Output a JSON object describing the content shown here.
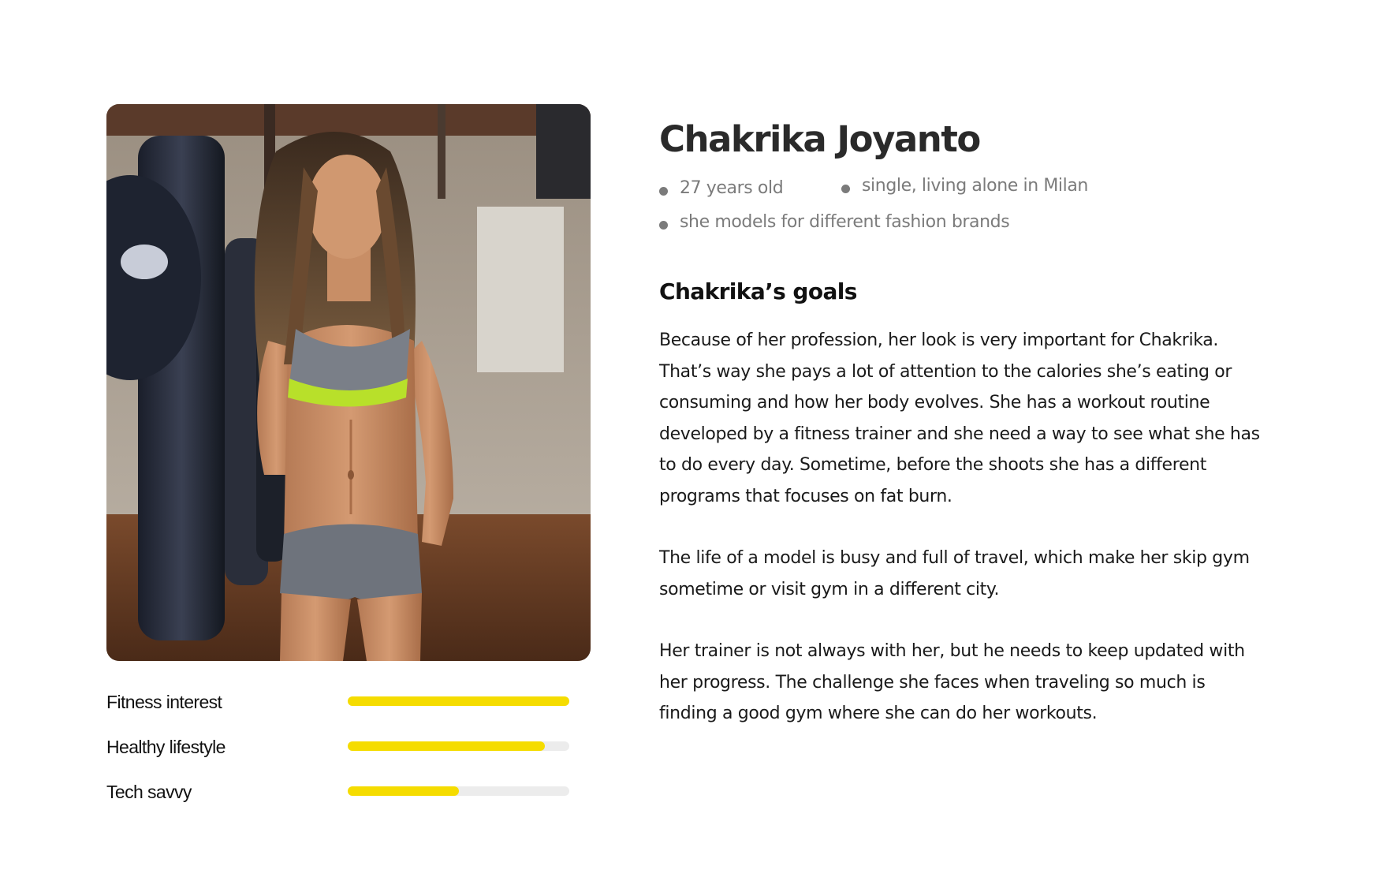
{
  "persona": {
    "name": "Chakrika Joyanto",
    "facts": [
      "27 years old",
      "single, living alone in Milan",
      "she models for different fashion brands"
    ],
    "goals_heading": "Chakrika’s goals",
    "paragraphs": [
      "Because of her profession, her look is very important for Chakrika. That’s way she pays a lot of attention to the calories she’s eating or consuming and how her body evolves. She has a workout routine developed by a fitness trainer and she need a way to see what she has to do every day. Sometime, before the shoots she has a different programs that focuses on fat burn.",
      "The life of a model is busy and full of travel, which make her skip gym sometime or visit gym in a different city.",
      "Her trainer is not always with her, but he needs to keep updated with her progress. The challenge she faces when traveling so much is finding a good gym where she can do her workouts."
    ]
  },
  "skills": [
    {
      "label": "Fitness interest",
      "level": 1.0
    },
    {
      "label": "Healthy lifestyle",
      "level": 0.89
    },
    {
      "label": "Tech savvy",
      "level": 0.5
    }
  ],
  "colors": {
    "accent": "#f5dc00",
    "track": "#ececec",
    "muted_text": "#7b7b7b"
  }
}
